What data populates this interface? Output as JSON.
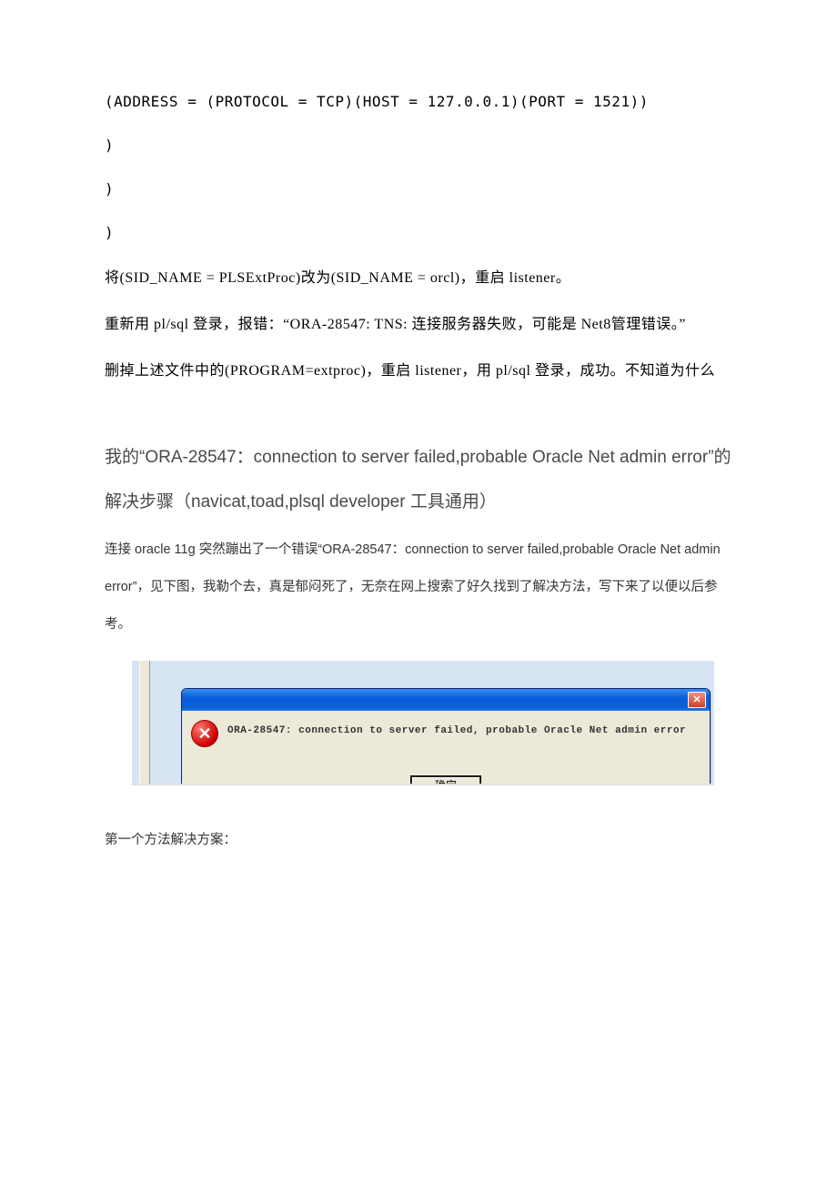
{
  "code": {
    "line1": "(ADDRESS = (PROTOCOL = TCP)(HOST = 127.0.0.1)(PORT = 1521))",
    "close1": ")",
    "close2": ")",
    "close3": ")"
  },
  "prose": {
    "p1": "将(SID_NAME = PLSExtProc)改为(SID_NAME = orcl)，重启 listener。",
    "p2": "重新用 pl/sql 登录，报错：“ORA-28547: TNS: 连接服务器失败，可能是 Net8管理错误。”",
    "p3": "删掉上述文件中的(PROGRAM=extproc)，重启 listener，用 pl/sql 登录，成功。不知道为什么"
  },
  "heading": "我的“ORA-28547：connection to server failed,probable Oracle Net admin error”的解决步骤（navicat,toad,plsql developer 工具通用）",
  "intro": "连接 oracle 11g 突然蹦出了一个错误“ORA-28547：connection to server failed,probable Oracle Net admin error”，见下图，我勒个去，真是郁闷死了，无奈在网上搜索了好久找到了解决方法，写下来了以便以后参考。",
  "dialog": {
    "message": "ORA-28547: connection to server failed, probable Oracle Net admin error",
    "ok_label": "确定",
    "close_glyph": "✕",
    "err_glyph": "✕"
  },
  "footer": "第一个方法解决方案："
}
